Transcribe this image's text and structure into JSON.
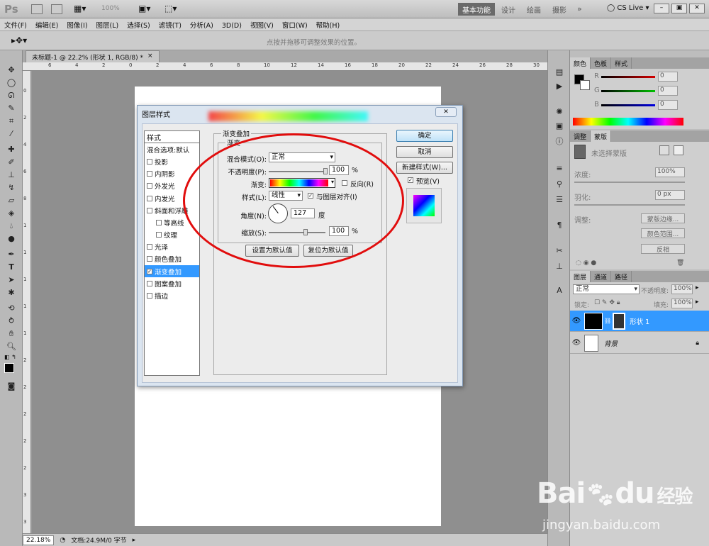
{
  "app": {
    "logo": "Ps",
    "zoom_display": "100%",
    "workspace_buttons": [
      "基本功能",
      "设计",
      "绘画",
      "摄影"
    ],
    "more": "»",
    "cs_live": "CS Live",
    "win_buttons": [
      "–",
      "▣",
      "✕"
    ]
  },
  "menu": [
    "文件(F)",
    "编辑(E)",
    "图像(I)",
    "图层(L)",
    "选择(S)",
    "滤镜(T)",
    "分析(A)",
    "3D(D)",
    "视图(V)",
    "窗口(W)",
    "帮助(H)"
  ],
  "options": {
    "hint": "点按并拖移可调整效果的位置。"
  },
  "document": {
    "tab_title": "未标题-1 @ 22.2% (形状 1, RGB/8) *",
    "tab_close": "×"
  },
  "ruler": {
    "top": [
      "6",
      "4",
      "2",
      "0",
      "2",
      "4",
      "6",
      "8",
      "10",
      "12",
      "14",
      "16",
      "18",
      "20",
      "22",
      "24",
      "26",
      "28",
      "30"
    ],
    "left": [
      "0",
      "2",
      "4",
      "6",
      "8",
      "1",
      "1",
      "1",
      "1",
      "1",
      "2",
      "2",
      "2",
      "2",
      "2",
      "3",
      "3",
      "3"
    ]
  },
  "status": {
    "zoom": "22.18%",
    "doc": "文档:24.9M/0 字节"
  },
  "dialog": {
    "title": "图层样式",
    "close": "✕",
    "styles": [
      {
        "label": "样式",
        "checkbox": false,
        "checked": false,
        "indent": false,
        "selected": false
      },
      {
        "label": "混合选项:默认",
        "checkbox": false,
        "checked": false,
        "indent": false,
        "selected": false
      },
      {
        "label": "投影",
        "checkbox": true,
        "checked": false,
        "indent": false,
        "selected": false
      },
      {
        "label": "内阴影",
        "checkbox": true,
        "checked": false,
        "indent": false,
        "selected": false
      },
      {
        "label": "外发光",
        "checkbox": true,
        "checked": false,
        "indent": false,
        "selected": false
      },
      {
        "label": "内发光",
        "checkbox": true,
        "checked": false,
        "indent": false,
        "selected": false
      },
      {
        "label": "斜面和浮雕",
        "checkbox": true,
        "checked": false,
        "indent": false,
        "selected": false
      },
      {
        "label": "等高线",
        "checkbox": true,
        "checked": false,
        "indent": true,
        "selected": false
      },
      {
        "label": "纹理",
        "checkbox": true,
        "checked": false,
        "indent": true,
        "selected": false
      },
      {
        "label": "光泽",
        "checkbox": true,
        "checked": false,
        "indent": false,
        "selected": false
      },
      {
        "label": "颜色叠加",
        "checkbox": true,
        "checked": false,
        "indent": false,
        "selected": false
      },
      {
        "label": "渐变叠加",
        "checkbox": true,
        "checked": true,
        "indent": false,
        "selected": true
      },
      {
        "label": "图案叠加",
        "checkbox": true,
        "checked": false,
        "indent": false,
        "selected": false
      },
      {
        "label": "描边",
        "checkbox": true,
        "checked": false,
        "indent": false,
        "selected": false
      }
    ],
    "group_title": "渐变叠加",
    "subgroup_title": "渐变",
    "blend_mode_label": "混合模式(O):",
    "blend_mode_value": "正常",
    "opacity_label": "不透明度(P):",
    "opacity_value": "100",
    "opacity_percent": 100,
    "percent_sign": "%",
    "gradient_label": "渐变:",
    "reverse_label": "反向(R)",
    "reverse_checked": false,
    "style_label": "样式(L):",
    "style_value": "线性",
    "align_label": "与图层对齐(I)",
    "align_checked": true,
    "angle_label": "角度(N):",
    "angle_value": "127",
    "angle_unit": "度",
    "scale_label": "缩放(S):",
    "scale_value": "100",
    "scale_percent": 100,
    "btn_set_default": "设置为默认值",
    "btn_reset_default": "复位为默认值",
    "btn_ok": "确定",
    "btn_cancel": "取消",
    "btn_new_style": "新建样式(W)...",
    "preview_label": "预览(V)",
    "preview_checked": true,
    "check_mark": "✓"
  },
  "panels": {
    "color_tabs": [
      "颜色",
      "色板",
      "样式"
    ],
    "channels": [
      {
        "label": "R",
        "value": "0"
      },
      {
        "label": "G",
        "value": "0"
      },
      {
        "label": "B",
        "value": "0"
      }
    ],
    "adjust_tabs": [
      "调整",
      "蒙版"
    ],
    "mask": {
      "status": "未选择蒙版",
      "density_label": "浓度:",
      "density_value": "100%",
      "feather_label": "羽化:",
      "feather_value": "0 px",
      "refine_label": "调整:",
      "btn_mask_edge": "蒙版边缘...",
      "btn_color_range": "颜色范围...",
      "btn_invert": "反相"
    },
    "layers_tabs": [
      "图层",
      "通道",
      "路径"
    ],
    "layers": {
      "blend_mode": "正常",
      "opacity_label": "不透明度:",
      "opacity_value": "100%",
      "lock_label": "锁定:",
      "fill_label": "填充:",
      "fill_value": "100%",
      "items": [
        {
          "name": "形状 1",
          "selected": true
        },
        {
          "name": "背景",
          "selected": false
        }
      ]
    }
  },
  "watermark": {
    "brand": "Bai",
    "brand2": "du",
    "brand_cn": "经验",
    "url": "jingyan.baidu.com"
  },
  "colors": {
    "selection": "#3399ff",
    "annotation": "#e10d0d",
    "dialog_frame": "#dbe5f0"
  }
}
